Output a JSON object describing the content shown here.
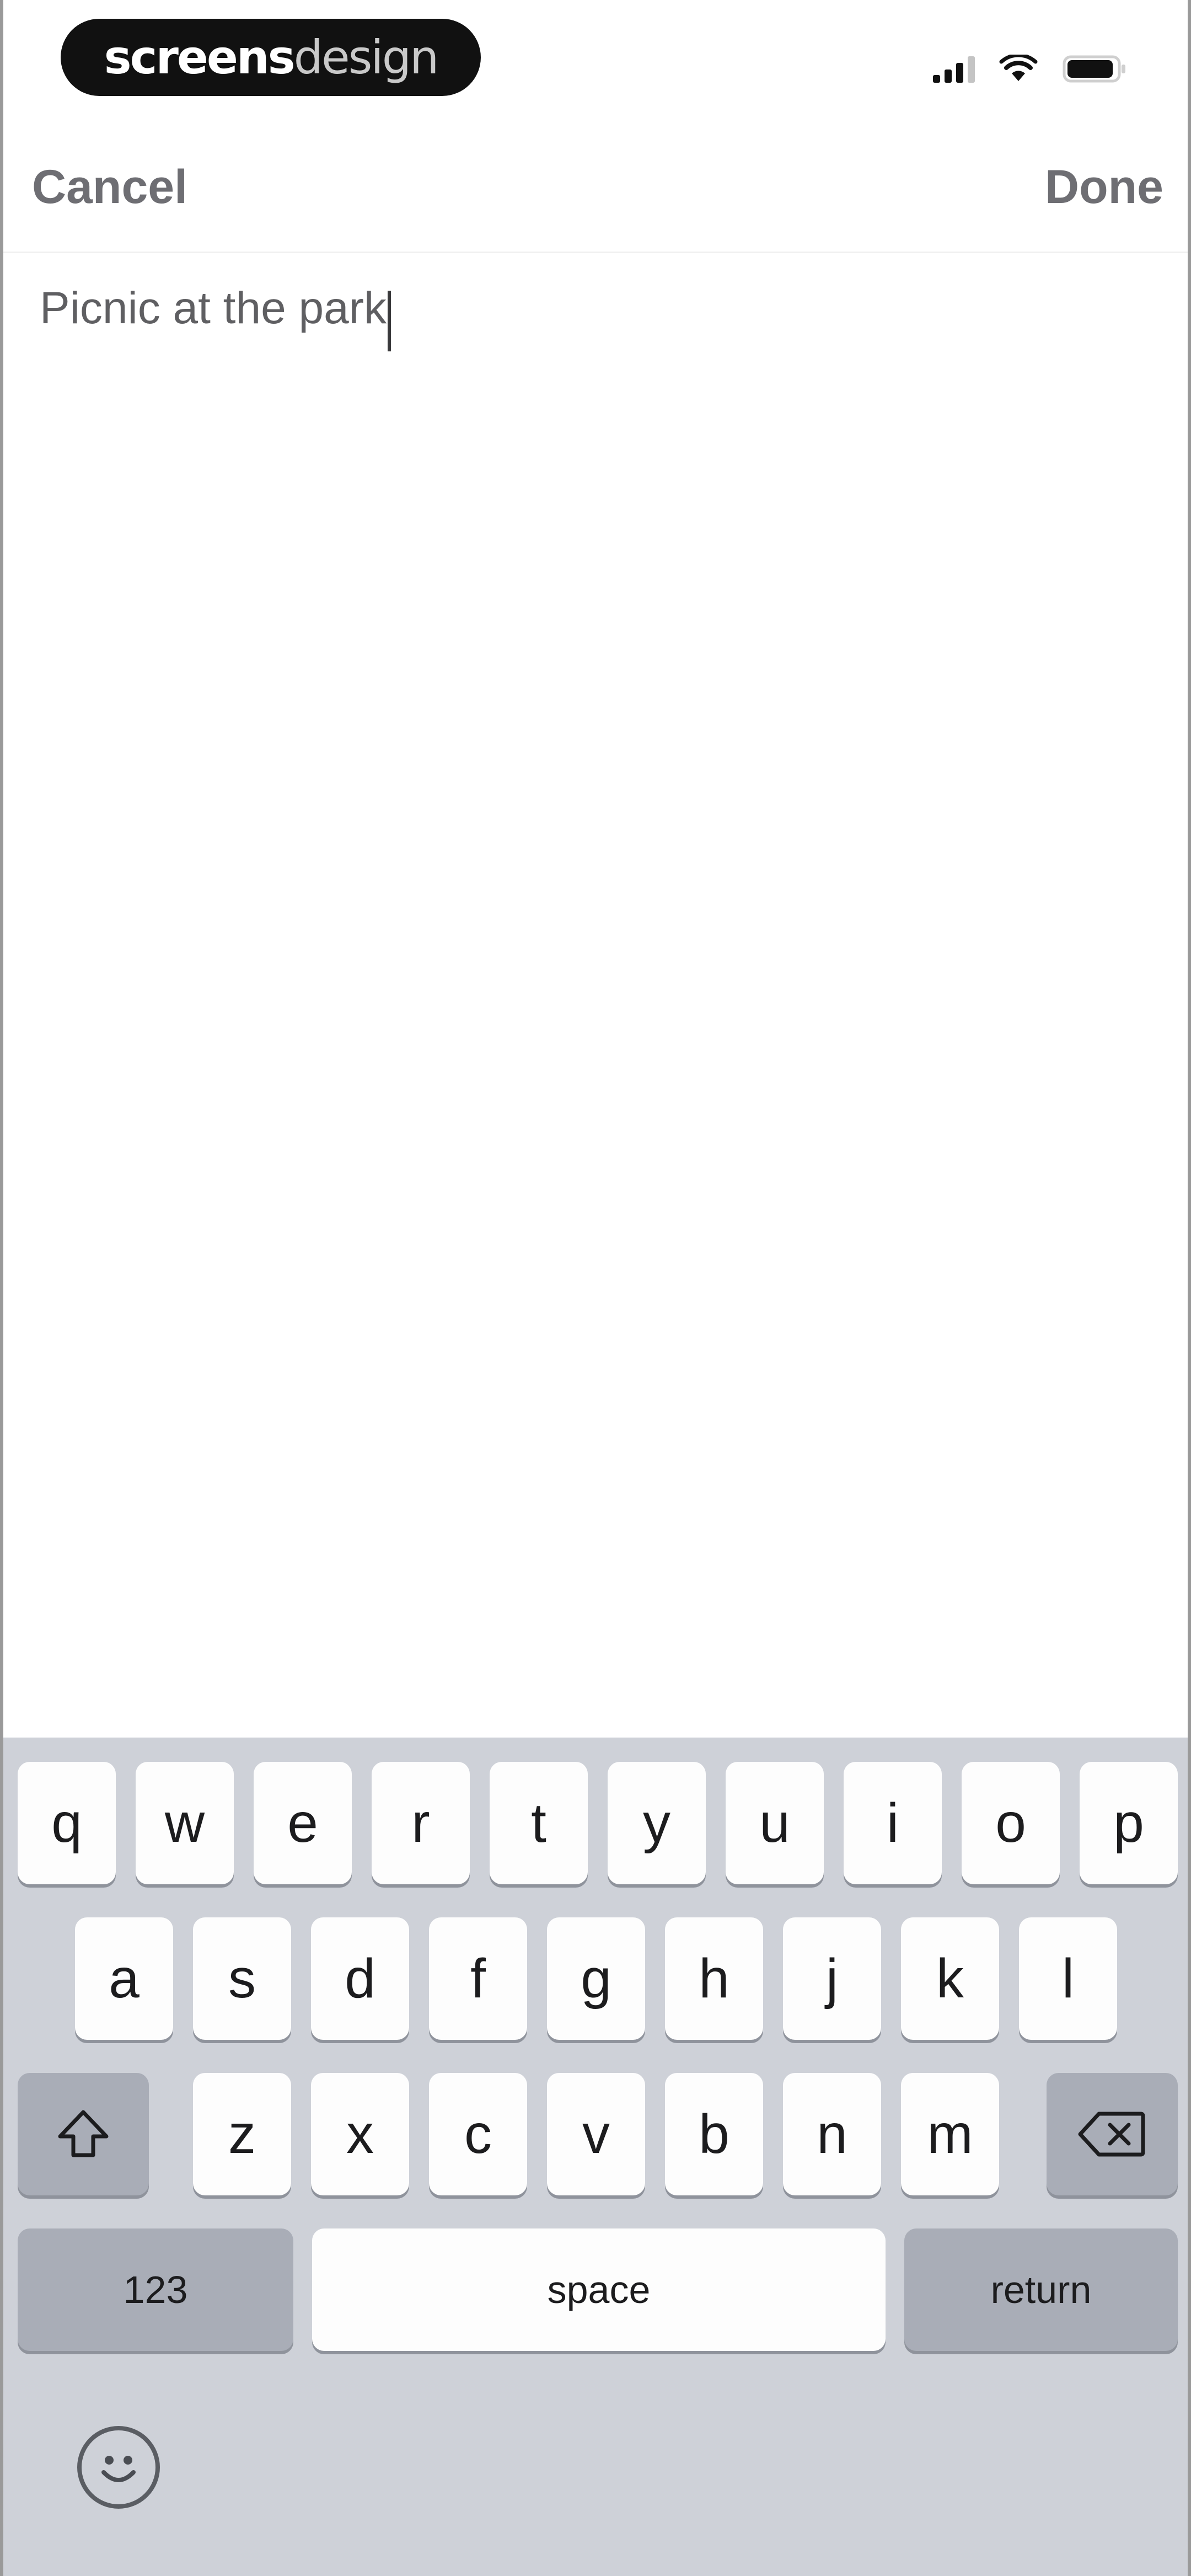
{
  "status_bar": {
    "brand_bold": "screens",
    "brand_light": "design",
    "signal_icon": "cellular-signal-icon",
    "wifi_icon": "wifi-icon",
    "battery_icon": "battery-icon"
  },
  "nav": {
    "cancel_label": "Cancel",
    "done_label": "Done"
  },
  "editor": {
    "value": "Picnic at the park"
  },
  "keyboard": {
    "row1": [
      "q",
      "w",
      "e",
      "r",
      "t",
      "y",
      "u",
      "i",
      "o",
      "p"
    ],
    "row2": [
      "a",
      "s",
      "d",
      "f",
      "g",
      "h",
      "j",
      "k",
      "l"
    ],
    "row3": [
      "z",
      "x",
      "c",
      "v",
      "b",
      "n",
      "m"
    ],
    "shift_icon": "shift-arrow-icon",
    "delete_icon": "backspace-icon",
    "numbers_label": "123",
    "space_label": "space",
    "return_label": "return",
    "emoji_icon": "emoji-smiley-icon"
  }
}
